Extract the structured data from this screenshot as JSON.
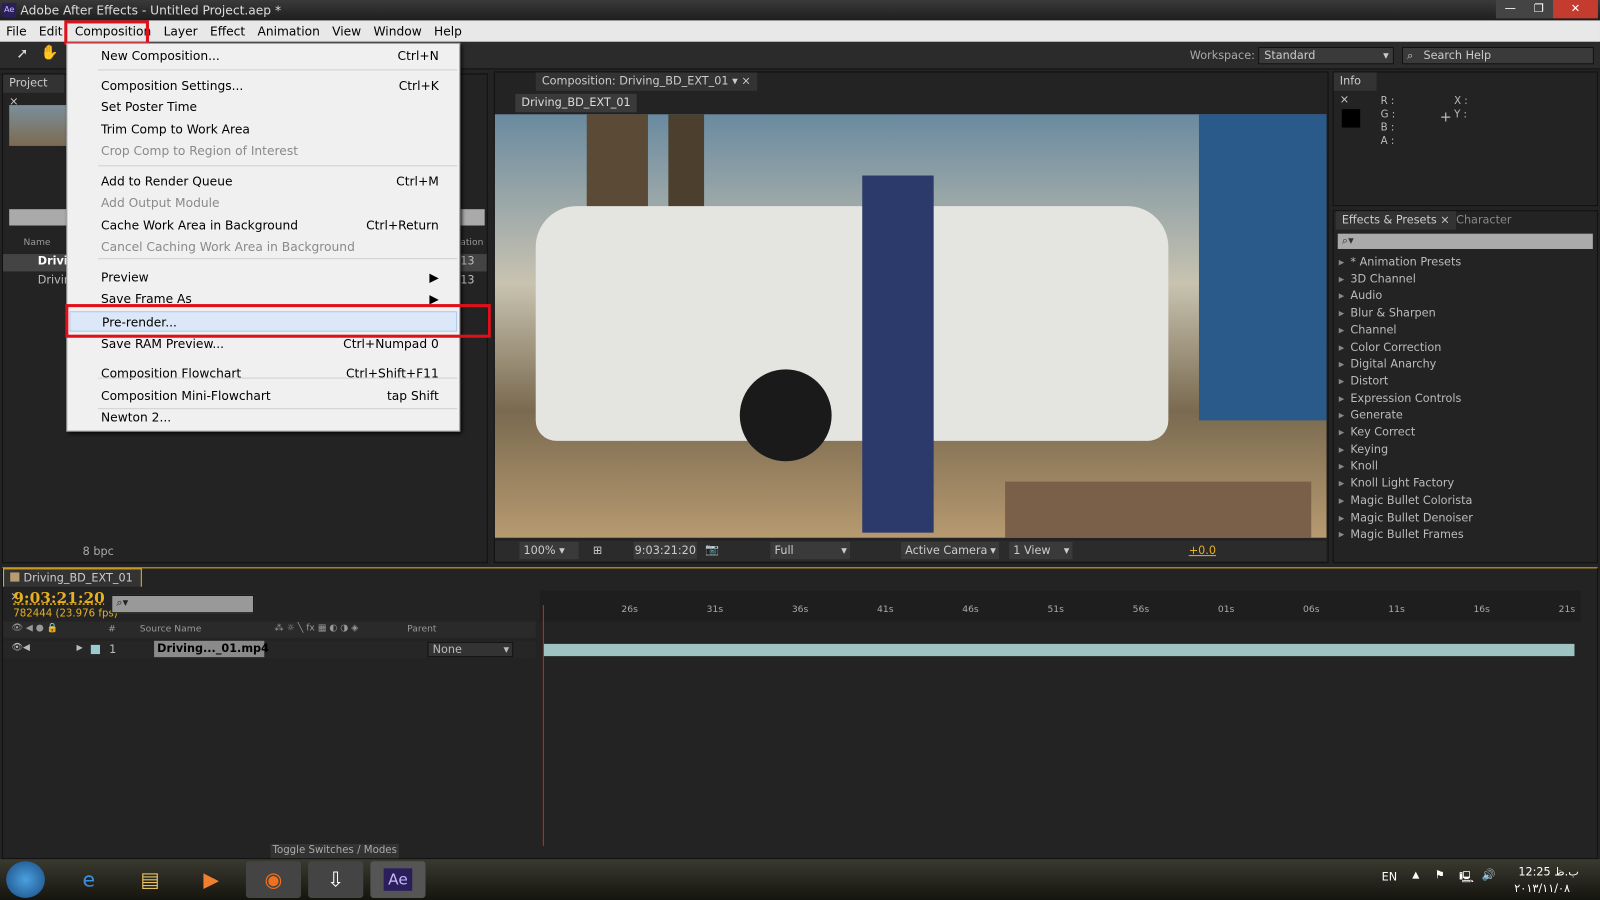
{
  "window": {
    "title": "Adobe After Effects - Untitled Project.aep *",
    "logo": "Ae",
    "controls": [
      "—",
      "❐",
      "✕"
    ]
  },
  "menubar": [
    "File",
    "Edit",
    "Composition",
    "Layer",
    "Effect",
    "Animation",
    "View",
    "Window",
    "Help"
  ],
  "toolbar": {
    "workspace_label": "Workspace:",
    "workspace_value": "Standard",
    "search_placeholder": "Search Help"
  },
  "composition_menu": [
    {
      "label": "New Composition...",
      "shortcut": "Ctrl+N"
    },
    {
      "label": "Composition Settings...",
      "shortcut": "Ctrl+K"
    },
    {
      "label": "Set Poster Time",
      "shortcut": ""
    },
    {
      "label": "Trim Comp to Work Area",
      "shortcut": ""
    },
    {
      "label": "Crop Comp to Region of Interest",
      "shortcut": "",
      "disabled": true
    },
    {
      "label": "Add to Render Queue",
      "shortcut": "Ctrl+M"
    },
    {
      "label": "Add Output Module",
      "shortcut": "",
      "disabled": true
    },
    {
      "label": "Cache Work Area in Background",
      "shortcut": "Ctrl+Return"
    },
    {
      "label": "Cancel Caching Work Area in Background",
      "shortcut": "",
      "disabled": true
    },
    {
      "label": "Preview",
      "shortcut": "▶"
    },
    {
      "label": "Save Frame As",
      "shortcut": "▶"
    },
    {
      "label": "Pre-render...",
      "shortcut": "",
      "highlighted": true
    },
    {
      "label": "Save RAM Preview...",
      "shortcut": "Ctrl+Numpad 0"
    },
    {
      "label": "Composition Flowchart",
      "shortcut": "Ctrl+Shift+F11"
    },
    {
      "label": "Composition Mini-Flowchart",
      "shortcut": "tap Shift"
    },
    {
      "label": "Newton 2...",
      "shortcut": ""
    }
  ],
  "project": {
    "tab": "Project",
    "col_name": "Name",
    "col_duration": "ation",
    "items": [
      "Drivin",
      "Drivin"
    ],
    "durations": [
      "13",
      "13"
    ],
    "bpc": "8 bpc"
  },
  "viewer": {
    "tab": "Composition: Driving_BD_EXT_01",
    "subtab": "Driving_BD_EXT_01",
    "zoom": "100%",
    "timecode": "9:03:21:20",
    "resolution": "Full",
    "camera": "Active Camera",
    "views": "1 View",
    "exposure": "+0.0"
  },
  "info": {
    "tab": "Info",
    "labels": [
      "R :",
      "G :",
      "B :",
      "A :"
    ],
    "xy": [
      "X :",
      "Y :"
    ]
  },
  "effects": {
    "tab": "Effects & Presets",
    "tab2": "Character",
    "items": [
      "* Animation Presets",
      "3D Channel",
      "Audio",
      "Blur & Sharpen",
      "Channel",
      "Color Correction",
      "Digital Anarchy",
      "Distort",
      "Expression Controls",
      "Generate",
      "Key Correct",
      "Keying",
      "Knoll",
      "Knoll Light Factory",
      "Magic Bullet Colorista",
      "Magic Bullet Denoiser",
      "Magic Bullet Frames"
    ]
  },
  "timeline": {
    "tab": "Driving_BD_EXT_01",
    "timecode": "9:03:21:20",
    "frames": "782444 (23.976 fps)",
    "col_num": "#",
    "col_source": "Source Name",
    "col_parent": "Parent",
    "layer": {
      "index": "1",
      "name": "Driving..._01.mp4",
      "parent": "None"
    },
    "ruler": [
      "26s",
      "31s",
      "36s",
      "41s",
      "46s",
      "51s",
      "56s",
      "01s",
      "06s",
      "11s",
      "16s",
      "21s"
    ],
    "toggle": "Toggle Switches / Modes",
    "accent": "#e8b020"
  },
  "taskbar": {
    "lang": "EN",
    "time": "12:25 ب.ظ",
    "date": "٢٠١٣/١١/٠٨"
  }
}
